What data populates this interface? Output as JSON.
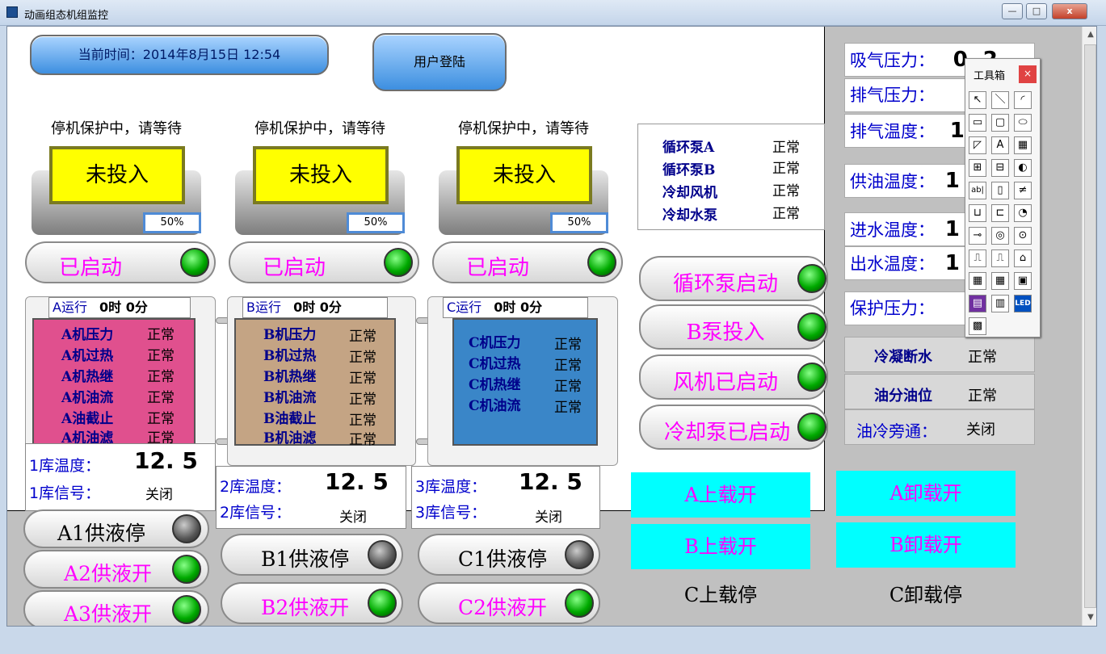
{
  "window": {
    "title": "动画组态机组监控",
    "minimize": "—",
    "maximize": "□",
    "close": "x"
  },
  "header": {
    "time_label": "当前时间：2014年8月15日 12:54",
    "login_label": "用户登陆"
  },
  "units": [
    {
      "warning": "停机保护中，请等待",
      "status": "未投入",
      "load": "50%",
      "start_label": "已启动",
      "run_label": "A运行",
      "run_time": "0时  0分",
      "items": [
        {
          "name": "A机压力",
          "state": "正常"
        },
        {
          "name": "A机过热",
          "state": "正常"
        },
        {
          "name": "A机热继",
          "state": "正常"
        },
        {
          "name": "A机油流",
          "state": "正常"
        },
        {
          "name": "A油截止",
          "state": "正常"
        },
        {
          "name": "A机油滤",
          "state": "正常"
        }
      ],
      "temp_label": "1库温度：",
      "temp_value": "12. 5",
      "signal_label": "1库信号：",
      "signal_value": "关闭"
    },
    {
      "warning": "停机保护中，请等待",
      "status": "未投入",
      "load": "50%",
      "start_label": "已启动",
      "run_label": "B运行",
      "run_time": "0时  0分",
      "items": [
        {
          "name": "B机压力",
          "state": "正常"
        },
        {
          "name": "B机过热",
          "state": "正常"
        },
        {
          "name": "B机热继",
          "state": "正常"
        },
        {
          "name": "B机油流",
          "state": "正常"
        },
        {
          "name": "B油截止",
          "state": "正常"
        },
        {
          "name": "B机油滤",
          "state": "正常"
        }
      ],
      "temp_label": "2库温度：",
      "temp_value": "12. 5",
      "signal_label": "2库信号：",
      "signal_value": "关闭"
    },
    {
      "warning": "停机保护中，请等待",
      "status": "未投入",
      "load": "50%",
      "start_label": "已启动",
      "run_label": "C运行",
      "run_time": "0时  0分",
      "items": [
        {
          "name": "C机压力",
          "state": "正常"
        },
        {
          "name": "C机过热",
          "state": "正常"
        },
        {
          "name": "C机热继",
          "state": "正常"
        },
        {
          "name": "C机油流",
          "state": "正常"
        }
      ],
      "temp_label": "3库温度：",
      "temp_value": "12. 5",
      "signal_label": "3库信号：",
      "signal_value": "关闭"
    }
  ],
  "pumps": {
    "items": [
      {
        "name": "循环泵A",
        "state": "正常"
      },
      {
        "name": "循环泵B",
        "state": "正常"
      },
      {
        "name": "冷却风机",
        "state": "正常"
      },
      {
        "name": "冷却水泵",
        "state": "正常"
      }
    ]
  },
  "pump_buttons": [
    "循环泵启动",
    "B泵投入",
    "风机已启动",
    "冷却泵已启动"
  ],
  "supply_buttons": {
    "a1": "A1供液停",
    "a2": "A2供液开",
    "a3": "A3供液开",
    "b1": "B1供液停",
    "b2": "B2供液开",
    "c1": "C1供液停",
    "c2": "C2供液开"
  },
  "load_buttons": {
    "a_up": "A上载开",
    "b_up": "B上载开",
    "c_up": "C上载停",
    "a_down": "A卸载开",
    "b_down": "B卸载开",
    "c_down": "C卸载停"
  },
  "readouts": {
    "suction_label": "吸气压力：",
    "suction_value": "0. 2",
    "discharge_pressure_label": "排气压力：",
    "discharge_temp_label": "排气温度：",
    "discharge_temp_value": "1",
    "oil_temp_label": "供油温度：",
    "oil_temp_value": "1",
    "water_in_label": "进水温度：",
    "water_in_value": "1",
    "water_out_label": "出水温度：",
    "water_out_value": "1",
    "protect_label": "保护压力："
  },
  "alarms": [
    {
      "name": "冷凝断水",
      "state": "正常"
    },
    {
      "name": "油分油位",
      "state": "正常"
    },
    {
      "name": "油冷旁通：",
      "state": "关闭"
    }
  ],
  "toolbox": {
    "title": "工具箱",
    "close": "×",
    "tools": [
      "↖",
      "＼",
      "◜",
      "▭",
      "▢",
      "⬭",
      "◸",
      "A",
      "▦",
      "⊞",
      "⊟",
      "◐",
      "ab|",
      "▯",
      "≠",
      "⊔",
      "⊏",
      "◔",
      "⊸",
      "◎",
      "⊙",
      "⎍",
      "⎍",
      "⌂",
      "▦",
      "▦",
      "▣",
      "▤",
      "▥",
      "LED",
      "▩"
    ]
  },
  "colors": {
    "accent_magenta": "#ff00ff",
    "cyan_button": "#00ffff",
    "status_yellow": "#ffff00",
    "led_green": "#00aa00"
  }
}
